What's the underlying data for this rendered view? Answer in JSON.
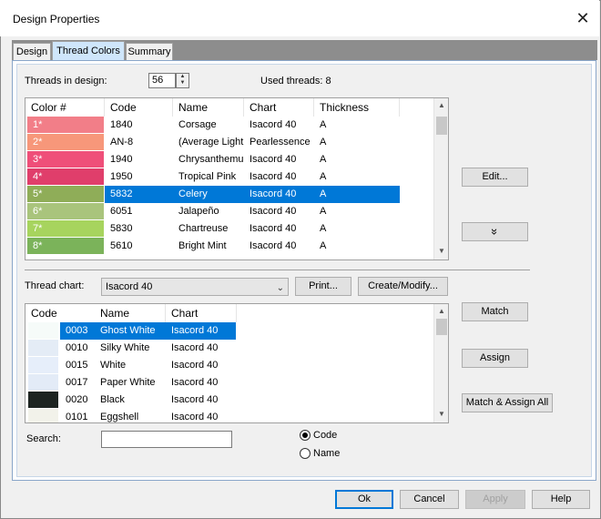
{
  "window": {
    "title": "Design Properties",
    "close_glyph": "✕"
  },
  "tabs": [
    {
      "label": "Design",
      "active": false
    },
    {
      "label": "Thread Colors",
      "active": true
    },
    {
      "label": "Summary",
      "active": false
    }
  ],
  "threads": {
    "label": "Threads in design:",
    "count": "56",
    "used_label": "Used threads: 8"
  },
  "design_table": {
    "columns": [
      "Color #",
      "Code",
      "Name",
      "Chart",
      "Thickness"
    ],
    "rows": [
      {
        "num": "1*",
        "code": "1840",
        "name": "Corsage",
        "chart": "Isacord 40",
        "thickness": "A",
        "color": "#f27e88",
        "selected": false
      },
      {
        "num": "2*",
        "code": "AN-8",
        "name": "(Average Light",
        "chart": "Pearlessence",
        "thickness": "A",
        "color": "#f7977a",
        "selected": false
      },
      {
        "num": "3*",
        "code": "1940",
        "name": "Chrysanthemum",
        "chart": "Isacord 40",
        "thickness": "A",
        "color": "#ef4f79",
        "selected": false
      },
      {
        "num": "4*",
        "code": "1950",
        "name": "Tropical Pink",
        "chart": "Isacord 40",
        "thickness": "A",
        "color": "#e03e6b",
        "selected": false
      },
      {
        "num": "5*",
        "code": "5832",
        "name": "Celery",
        "chart": "Isacord 40",
        "thickness": "A",
        "color": "#8fad58",
        "selected": true
      },
      {
        "num": "6*",
        "code": "6051",
        "name": "Jalapeño",
        "chart": "Isacord 40",
        "thickness": "A",
        "color": "#a9c47c",
        "selected": false
      },
      {
        "num": "7*",
        "code": "5830",
        "name": "Chartreuse",
        "chart": "Isacord 40",
        "thickness": "A",
        "color": "#a7d45e",
        "selected": false
      },
      {
        "num": "8*",
        "code": "5610",
        "name": "Bright Mint",
        "chart": "Isacord 40",
        "thickness": "A",
        "color": "#7bb35a",
        "selected": false
      }
    ]
  },
  "side_buttons": {
    "edit": "Edit...",
    "expand_glyph": "»"
  },
  "thread_chart": {
    "label": "Thread chart:",
    "selected": "Isacord 40",
    "print": "Print...",
    "create_modify": "Create/Modify..."
  },
  "chart_table": {
    "columns": [
      "Code",
      "Name",
      "Chart"
    ],
    "rows": [
      {
        "code": "0003",
        "name": "Ghost White",
        "chart": "Isacord 40",
        "color": "#f6fbf9",
        "selected": true
      },
      {
        "code": "0010",
        "name": "Silky White",
        "chart": "Isacord 40",
        "color": "#e4ecf6",
        "selected": false
      },
      {
        "code": "0015",
        "name": "White",
        "chart": "Isacord 40",
        "color": "#e6eefa",
        "selected": false
      },
      {
        "code": "0017",
        "name": "Paper White",
        "chart": "Isacord 40",
        "color": "#e3ebf7",
        "selected": false
      },
      {
        "code": "0020",
        "name": "Black",
        "chart": "Isacord 40",
        "color": "#1d2421",
        "selected": false
      },
      {
        "code": "0101",
        "name": "Eggshell",
        "chart": "Isacord 40",
        "color": "#f2f2ea",
        "selected": false
      }
    ]
  },
  "match_buttons": {
    "match": "Match",
    "assign": "Assign",
    "match_assign_all": "Match & Assign All"
  },
  "search": {
    "label": "Search:",
    "value": "",
    "options": [
      {
        "label": "Code",
        "checked": true
      },
      {
        "label": "Name",
        "checked": false
      }
    ]
  },
  "footer": {
    "ok": "Ok",
    "cancel": "Cancel",
    "apply": "Apply",
    "help": "Help"
  },
  "colors": {
    "selection": "#0078d7",
    "tab_active": "#cfe6fb"
  }
}
